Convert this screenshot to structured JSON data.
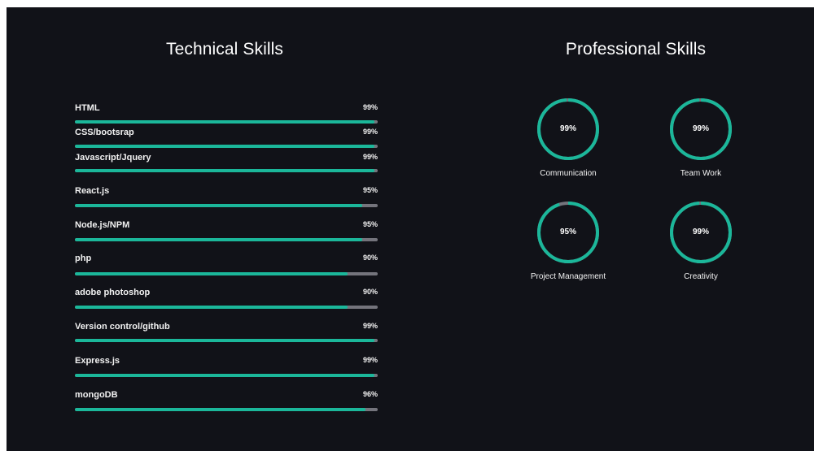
{
  "technical": {
    "title": "Technical Skills",
    "skills": [
      {
        "name": "HTML",
        "percent_label": "99%",
        "value": 99
      },
      {
        "name": "CSS/bootsrap",
        "percent_label": "99%",
        "value": 99
      },
      {
        "name": "Javascript/Jquery",
        "percent_label": "99%",
        "value": 99
      },
      {
        "name": "React.js",
        "percent_label": "95%",
        "value": 95
      },
      {
        "name": "Node.js/NPM",
        "percent_label": "95%",
        "value": 95
      },
      {
        "name": "php",
        "percent_label": "90%",
        "value": 90
      },
      {
        "name": "adobe photoshop",
        "percent_label": "90%",
        "value": 90
      },
      {
        "name": "Version control/github",
        "percent_label": "99%",
        "value": 99
      },
      {
        "name": "Express.js",
        "percent_label": "99%",
        "value": 99
      },
      {
        "name": "mongoDB",
        "percent_label": "96%",
        "value": 96
      }
    ]
  },
  "professional": {
    "title": "Professional Skills",
    "skills": [
      {
        "name": "Communication",
        "percent_label": "99%",
        "value": 99
      },
      {
        "name": "Team Work",
        "percent_label": "99%",
        "value": 99
      },
      {
        "name": "Project Management",
        "percent_label": "95%",
        "value": 95
      },
      {
        "name": "Creativity",
        "percent_label": "99%",
        "value": 99
      }
    ]
  },
  "colors": {
    "background": "#111218",
    "accent": "#1bb79a",
    "track": "#74747c",
    "text": "#ffffff"
  }
}
